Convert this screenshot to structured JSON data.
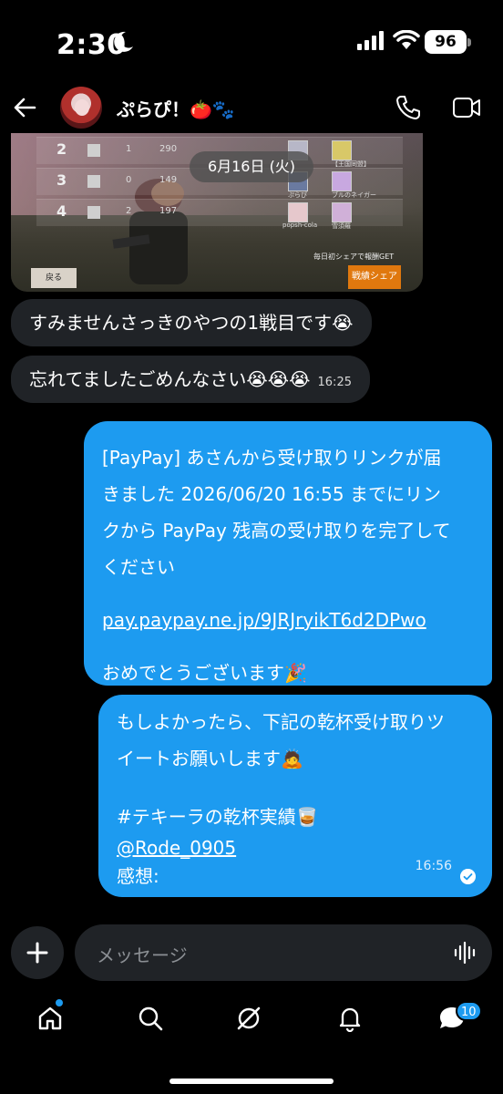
{
  "status_bar": {
    "time": "2:30",
    "battery": "96"
  },
  "header": {
    "name": "ぷらぴ！🍅🐾"
  },
  "screenshot": {
    "rows": [
      {
        "rank": "2",
        "n1": "1",
        "n2": "290",
        "p1": "",
        "p2": "【王国同盟】"
      },
      {
        "rank": "3",
        "n1": "0",
        "n2": "149",
        "p1": "ぷらぴ",
        "p2": "ブルのネイガー"
      },
      {
        "rank": "4",
        "n1": "2",
        "n2": "197",
        "p1": "popsh-cola",
        "p2": "雪須羅"
      }
    ],
    "daily_text": "毎日初シェアで報酬GET",
    "back_label": "戻る",
    "share_label": "戦績シェア"
  },
  "date_pill": "6月16日 (火)",
  "messages": {
    "in1": {
      "text": "すみませんさっきのやつの1戦目です😭"
    },
    "in2": {
      "text": "忘れてましたごめんなさい😭😭😭",
      "time": "16:25"
    },
    "out1": {
      "line1": "[PayPay] あさんから受け取りリンクが届",
      "line2": "きました 2026/06/20 16:55 までにリン",
      "line3": "クから PayPay 残高の受け取りを完了して",
      "line4": "ください",
      "link": "pay.paypay.ne.jp/9JRJryikT6d2DPwo",
      "congrats": "おめでとうございます🎉"
    },
    "out2": {
      "line1": "もしよかったら、下記の乾杯受け取りツ",
      "line2": "イートお願いします🙇",
      "hashtag": "#テキーラの乾杯実績🥃",
      "mention": "@Rode_0905",
      "impression": "感想:",
      "time": "16:56"
    }
  },
  "composer": {
    "placeholder": "メッセージ"
  },
  "navbar": {
    "badge": "10"
  },
  "colors": {
    "accent": "#1d9bf0",
    "bubble_in": "#202327",
    "background": "#000000"
  }
}
